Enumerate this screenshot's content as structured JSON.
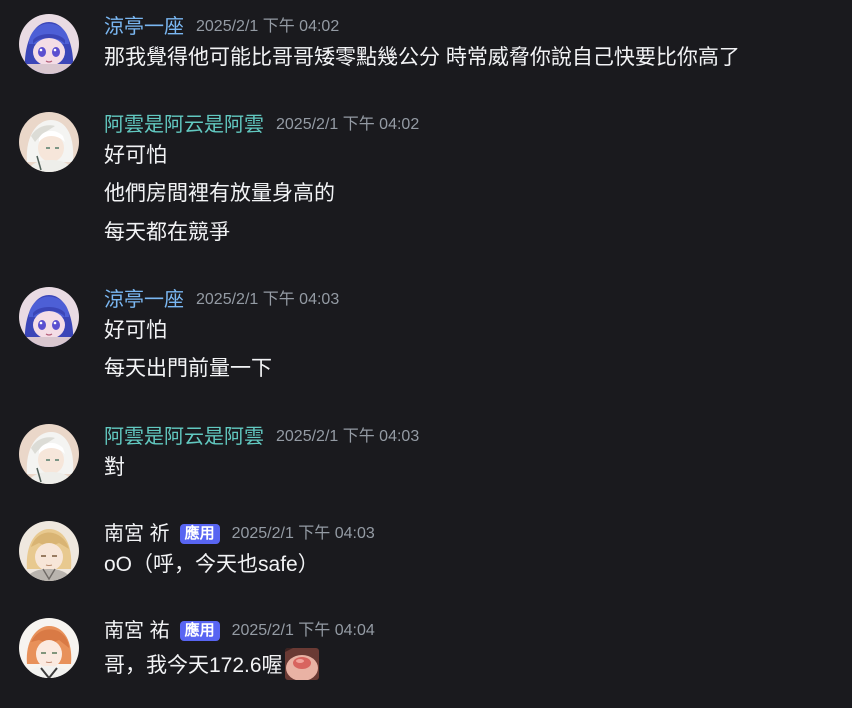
{
  "messages": [
    {
      "author": "涼亭一座",
      "timestamp": "2025/2/1 下午 04:02",
      "lines": [
        "那我覺得他可能比哥哥矮零點幾公分 時常威脅你說自己快要比你高了"
      ]
    },
    {
      "author": "阿雲是阿云是阿雲",
      "timestamp": "2025/2/1 下午 04:02",
      "lines": [
        "好可怕",
        "他們房間裡有放量身高的",
        "每天都在競爭"
      ]
    },
    {
      "author": "涼亭一座",
      "timestamp": "2025/2/1 下午 04:03",
      "lines": [
        "好可怕",
        "每天出門前量一下"
      ]
    },
    {
      "author": "阿雲是阿云是阿雲",
      "timestamp": "2025/2/1 下午 04:03",
      "lines": [
        "對"
      ]
    },
    {
      "author": "南宮 祈",
      "badge": "應用",
      "timestamp": "2025/2/1 下午 04:03",
      "lines": [
        "oO（呼，今天也safe）"
      ]
    },
    {
      "author": "南宮 祐",
      "badge": "應用",
      "timestamp": "2025/2/1 下午 04:04",
      "lines": [
        "哥，我今天172.6喔"
      ],
      "emoji": "blushing-face-emoji"
    }
  ],
  "colors": {
    "background": "#1a1a1e",
    "name_blue": "#7ab7f2",
    "name_teal": "#62c9c1",
    "badge": "#5865f2",
    "timestamp": "#949ba4"
  }
}
